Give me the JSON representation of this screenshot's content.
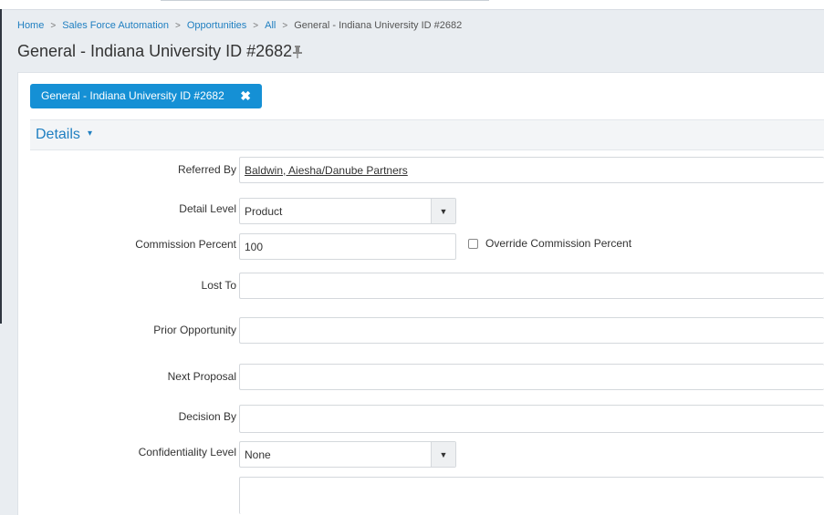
{
  "breadcrumb": {
    "items": [
      "Home",
      "Sales Force Automation",
      "Opportunities",
      "All"
    ],
    "current": "General - Indiana University ID #2682"
  },
  "page": {
    "title": "General - Indiana University ID #2682",
    "pin_icon": "pin-icon"
  },
  "record_tab": {
    "label": "General - Indiana University ID #2682",
    "close_icon": "✖"
  },
  "section": {
    "title": "Details",
    "caret": "▾"
  },
  "form": {
    "referred_by": {
      "label": "Referred By",
      "value": "Baldwin, Aiesha/Danube Partners"
    },
    "detail_level": {
      "label": "Detail Level",
      "value": "Product"
    },
    "commission_percent": {
      "label": "Commission Percent",
      "value": "100"
    },
    "override_commission": {
      "label": "Override Commission Percent",
      "checked": false
    },
    "lost_to": {
      "label": "Lost To",
      "value": ""
    },
    "prior_opportunity": {
      "label": "Prior Opportunity",
      "value": ""
    },
    "next_proposal": {
      "label": "Next Proposal",
      "value": ""
    },
    "decision_by": {
      "label": "Decision By",
      "value": ""
    },
    "confidentiality_level": {
      "label": "Confidentiality Level",
      "value": "None"
    }
  },
  "colors": {
    "accent": "#1590d5",
    "link": "#1f7fc1",
    "background": "#e9edf1"
  }
}
